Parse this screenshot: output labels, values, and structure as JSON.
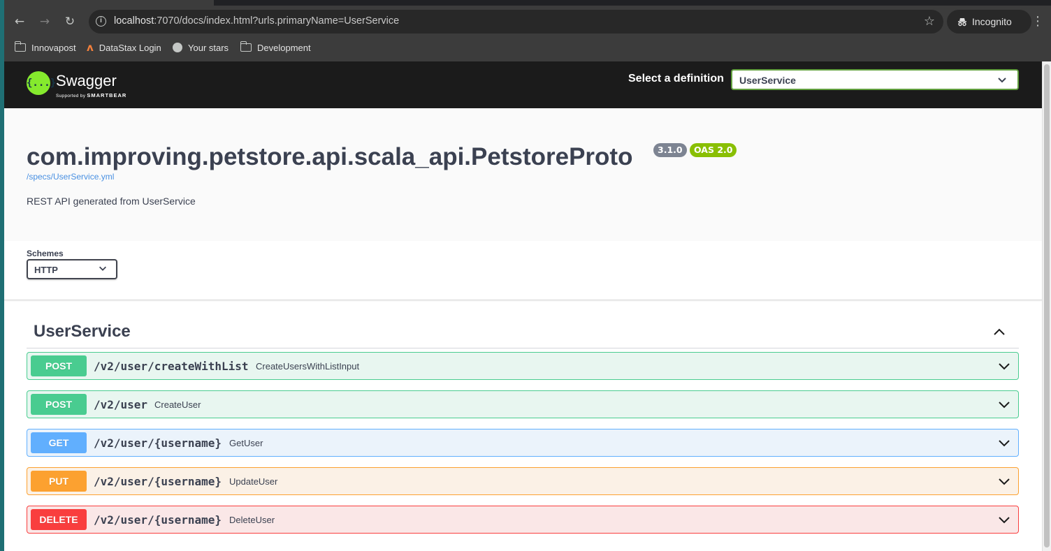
{
  "browser": {
    "url_host": "localhost",
    "url_rest": ":7070/docs/index.html?urls.primaryName=UserService",
    "profile_label": "Incognito",
    "bookmarks": [
      {
        "label": "Innovapost",
        "icon": "folder-icon"
      },
      {
        "label": "DataStax Login",
        "icon": "datastax-icon"
      },
      {
        "label": "Your stars",
        "icon": "github-icon"
      },
      {
        "label": "Development",
        "icon": "folder-icon"
      }
    ]
  },
  "swagger": {
    "logo_text": "Swagger",
    "logo_glyph": "{...}",
    "logo_sub_prefix": "Supported by",
    "logo_sub_brand": "SMARTBEAR",
    "definition_label": "Select a definition",
    "definition_value": "UserService"
  },
  "info": {
    "title": "com.improving.petstore.api.scala_api.PetstoreProto",
    "version_badge": "3.1.0",
    "oas_badge": "OAS 2.0",
    "spec_link": "/specs/UserService.yml",
    "description": "REST API generated from UserService"
  },
  "schemes": {
    "label": "Schemes",
    "value": "HTTP"
  },
  "tag": {
    "name": "UserService"
  },
  "operations": [
    {
      "method": "POST",
      "path": "/v2/user/createWithList",
      "summary": "CreateUsersWithListInput"
    },
    {
      "method": "POST",
      "path": "/v2/user",
      "summary": "CreateUser"
    },
    {
      "method": "GET",
      "path": "/v2/user/{username}",
      "summary": "GetUser"
    },
    {
      "method": "PUT",
      "path": "/v2/user/{username}",
      "summary": "UpdateUser"
    },
    {
      "method": "DELETE",
      "path": "/v2/user/{username}",
      "summary": "DeleteUser"
    }
  ],
  "colors": {
    "post": "#49cc90",
    "get": "#61affe",
    "put": "#fca130",
    "delete": "#f93e3e",
    "swagger_green": "#85ea2d"
  }
}
